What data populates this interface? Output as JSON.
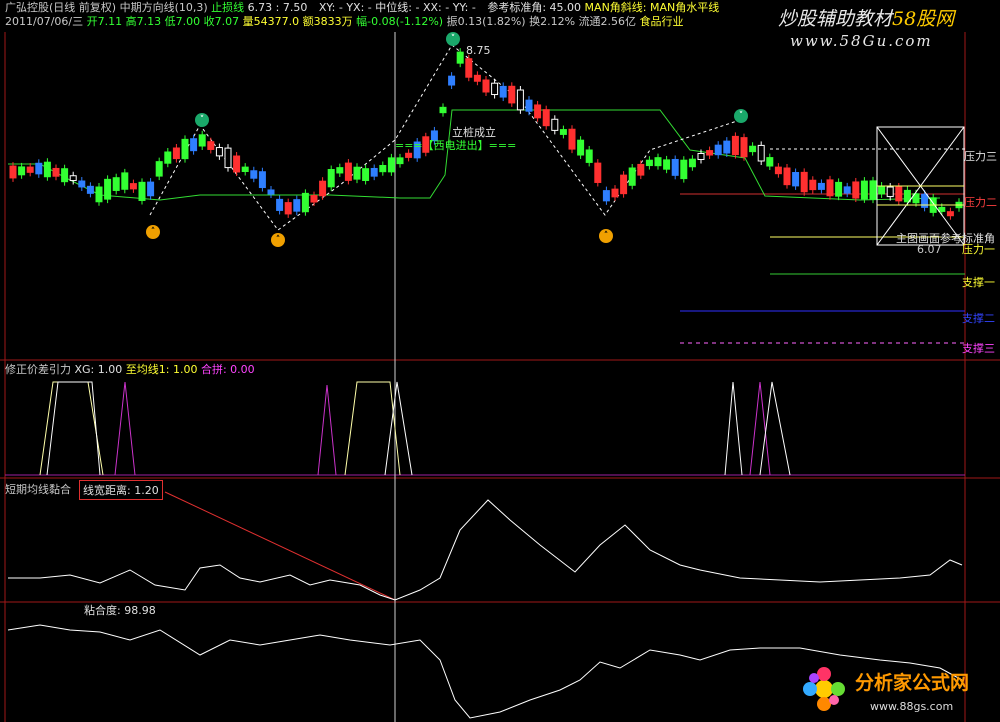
{
  "header": {
    "stock_name": "广弘控股(日线 前复权)",
    "indicator": "中期方向线(10,3)",
    "stop_label": "止损线",
    "stop_value": "6.73 : 7.50",
    "xy": "XY: -",
    "yx": "YX: -",
    "mid_label": "中位线: -",
    "xx": "XX: -",
    "yy": "YY: -",
    "ref_angle": "参考标准角: 45.00",
    "man_slope": "MAN角斜线:",
    "man_level": "MAN角水平线",
    "date": "2011/07/06/三",
    "open": "开7.11",
    "high": "高7.13",
    "low": "低7.00",
    "close": "收7.07",
    "volume": "量54377.0",
    "amount": "额3833万",
    "change": "幅-0.08(-1.12%)",
    "amplitude": "振0.13(1.82%)",
    "turnover": "换2.12%",
    "float": "流通2.56亿",
    "industry": "食品行业"
  },
  "watermark": {
    "top_title": "炒股辅助教材",
    "top_brand": "58股网",
    "top_url": "www.58Gu.com",
    "bottom_brand": "分析家公式网",
    "bottom_url": "www.88gs.com"
  },
  "main_chart": {
    "peak_label": "8.75",
    "stake_label": "立桩成立",
    "buy_label": "===【西电进出】===",
    "pressure_3": "压力三",
    "pressure_2": "压力二",
    "pressure_1": "压力一",
    "support_1": "支撑一",
    "support_2": "支撑二",
    "support_3": "支撑三",
    "box_label": "主图画面参考标准角",
    "box_value": "6.07",
    "colors": {
      "up": "#ff3030",
      "down_blue": "#2f7fff",
      "down_green": "#33ff33",
      "hollow": "#ffffff"
    }
  },
  "panel2": {
    "title": "修正价差引力",
    "xg": "XG: 1.00",
    "ma_line": "至均线1: 1.00",
    "combined": "合拼: 0.00"
  },
  "panel3": {
    "title": "短期均线黏合",
    "width_label": "线宽距离: 1.20"
  },
  "panel4": {
    "title": "粘合度: 98.98"
  }
}
